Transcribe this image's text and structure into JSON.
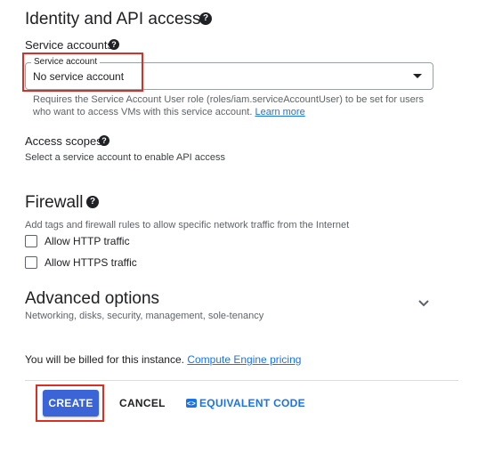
{
  "identity": {
    "title": "Identity and API access",
    "service_accounts_label": "Service accounts",
    "field_legend": "Service account",
    "field_value": "No service account",
    "help_text_1": "Requires the Service Account User role (roles/iam.serviceAccountUser) to be set for users",
    "help_text_2": "who want to access VMs with this service account.",
    "learn_more": "Learn more",
    "access_scopes_label": "Access scopes",
    "access_scopes_text": "Select a service account to enable API access"
  },
  "firewall": {
    "title": "Firewall",
    "description": "Add tags and firewall rules to allow specific network traffic from the Internet",
    "http_label": "Allow HTTP traffic",
    "https_label": "Allow HTTPS traffic",
    "http_checked": false,
    "https_checked": false
  },
  "advanced": {
    "title": "Advanced options",
    "subtitle": "Networking, disks, security, management, sole-tenancy"
  },
  "billing": {
    "text": "You will be billed for this instance.",
    "link": "Compute Engine pricing"
  },
  "actions": {
    "create": "CREATE",
    "cancel": "CANCEL",
    "equivalent_code": "EQUIVALENT CODE"
  },
  "icons": {
    "help": "help-icon",
    "dropdown": "dropdown-arrow-icon",
    "expand": "chevron-down-icon",
    "code": "code-icon"
  },
  "colors": {
    "highlight": "#d93025",
    "primary_button": "#3b64d6",
    "link": "#1a73e8"
  }
}
